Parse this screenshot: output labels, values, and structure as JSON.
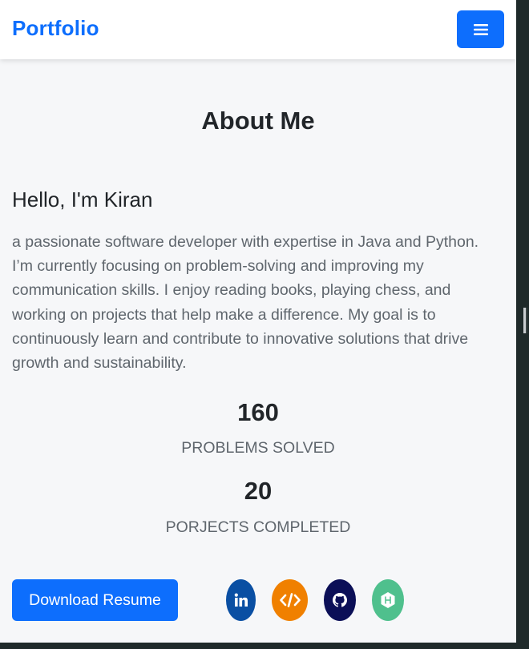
{
  "navbar": {
    "brand": "Portfolio",
    "menu_icon": "hamburger-menu-icon",
    "accent_color": "#0d6efd"
  },
  "about": {
    "title": "About Me",
    "greeting": "Hello, I'm Kiran",
    "bio": "a passionate software developer with expertise in Java and Python. I’m currently focusing on problem-solving and improving my communication skills. I enjoy reading books, playing chess, and working on projects that help make a difference. My goal is to continuously learn and contribute to innovative solutions that drive growth and sustainability."
  },
  "stats": [
    {
      "value": "160",
      "label": "PROBLEMS SOLVED"
    },
    {
      "value": "20",
      "label": "PORJECTS COMPLETED"
    }
  ],
  "actions": {
    "download_label": "Download Resume"
  },
  "social_links": [
    {
      "icon": "linkedin-icon",
      "color": "#0a4fa3"
    },
    {
      "icon": "code-icon",
      "color": "#f08000"
    },
    {
      "icon": "github-icon",
      "color": "#0b0f57"
    },
    {
      "icon": "hackerrank-icon",
      "color": "#4fc08d"
    }
  ]
}
